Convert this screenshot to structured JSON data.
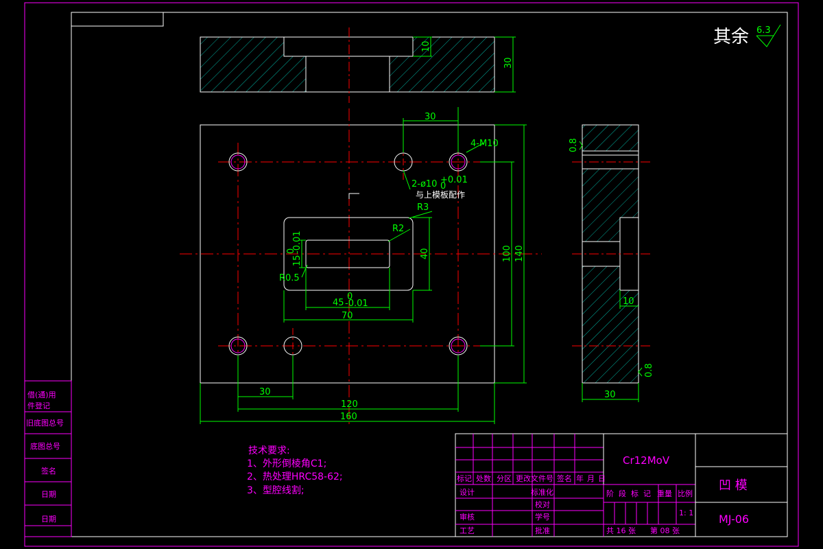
{
  "drawing": {
    "surface_finish": {
      "prefix": "其余",
      "value": "6.3"
    },
    "dimensions": {
      "top_depth": "10",
      "top_height": "30",
      "hole_spacing_top": "30",
      "tapped_holes": "4-M10",
      "dowel_holes": "2-ø10",
      "dowel_tol": "+0.01",
      "dowel_tol_low": "0",
      "dowel_note": "与上模板配作",
      "r3": "R3",
      "r2": "R2",
      "r05": "R0.5",
      "slot_height": "15",
      "slot_height_tol": "-0.01",
      "slot_height_tol_up": "0",
      "slot_width": "45",
      "slot_width_tol": "-0.01",
      "slot_width_tol_up": "0",
      "pocket_width": "70",
      "pocket_height": "40",
      "hole_v_spacing": "100",
      "plate_height": "140",
      "hole_h_offset": "30",
      "hole_h_spacing": "120",
      "plate_width": "160",
      "roughness_side": "0.8",
      "roughness_bottom": "0.8",
      "side_depth": "10",
      "side_width": "30"
    }
  },
  "tech_requirements": {
    "title": "技术要求:",
    "items": [
      "1、外形倒棱角C1;",
      "2、热处理HRC58-62;",
      "3、型腔线割;"
    ]
  },
  "left_block": {
    "labels": [
      "借(通)用",
      "件登记",
      "旧底图总号",
      "底图总号",
      "签名",
      "日期",
      "日期"
    ]
  },
  "title_block": {
    "material": "Cr12MoV",
    "part_name": "凹  模",
    "drawing_no": "MJ-06",
    "rev_headers": [
      "标记",
      "处数",
      "分区",
      "更改文件号",
      "签名",
      "年",
      "月",
      "日"
    ],
    "roles": [
      "设计",
      "标准化",
      "审核",
      "工艺",
      "批准"
    ],
    "role_extra": [
      "校对",
      "学号"
    ],
    "stage_headers": [
      "阶",
      "段",
      "标",
      "记",
      "重量",
      "比例"
    ],
    "scale": "1: 1",
    "sheet_total": "共 16 张",
    "sheet_no": "第 08 张"
  }
}
